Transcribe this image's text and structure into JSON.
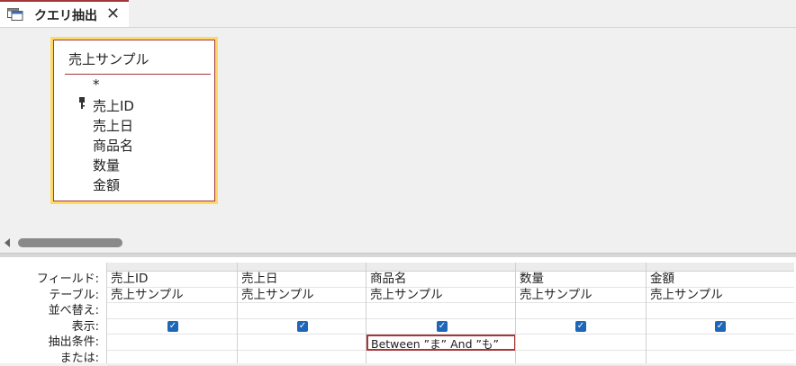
{
  "tab": {
    "label": "クエリ抽出",
    "close": "✕"
  },
  "table": {
    "title": "売上サンプル",
    "fields": [
      "*",
      "売上ID",
      "売上日",
      "商品名",
      "数量",
      "金額"
    ]
  },
  "grid": {
    "row_labels": [
      "フィールド:",
      "テーブル:",
      "並べ替え:",
      "表示:",
      "抽出条件:",
      "または:"
    ],
    "columns": [
      {
        "field": "売上ID",
        "table": "売上サンプル",
        "show": true,
        "criteria": ""
      },
      {
        "field": "売上日",
        "table": "売上サンプル",
        "show": true,
        "criteria": ""
      },
      {
        "field": "商品名",
        "table": "売上サンプル",
        "show": true,
        "criteria": "Between ”ま” And ”も”"
      },
      {
        "field": "数量",
        "table": "売上サンプル",
        "show": true,
        "criteria": ""
      },
      {
        "field": "金額",
        "table": "売上サンプル",
        "show": true,
        "criteria": ""
      }
    ]
  },
  "colors": {
    "accent": "#a4373a",
    "table_highlight": "#ffd965",
    "checkbox": "#1e66b8"
  }
}
